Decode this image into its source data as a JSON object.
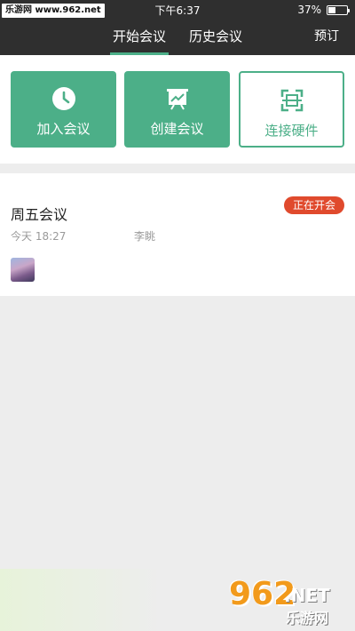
{
  "status_bar": {
    "watermark": "乐游网 www.962.net",
    "time": "下午6:37",
    "battery": "37%"
  },
  "nav": {
    "tabs": [
      {
        "label": "开始会议",
        "active": true
      },
      {
        "label": "历史会议",
        "active": false
      }
    ],
    "book_label": "预订",
    "accent": "#4caf88"
  },
  "actions": [
    {
      "label": "加入会议",
      "icon": "clock-icon"
    },
    {
      "label": "创建会议",
      "icon": "presentation-chart-icon"
    },
    {
      "label": "连接硬件",
      "icon": "scan-icon"
    }
  ],
  "meeting": {
    "title": "周五会议",
    "status": "正在开会",
    "time": "今天 18:27",
    "host": "李眺",
    "status_color": "#e04a2d"
  },
  "watermark_logo": {
    "big": "962",
    "net": ".NET",
    "cn": "乐游网"
  }
}
